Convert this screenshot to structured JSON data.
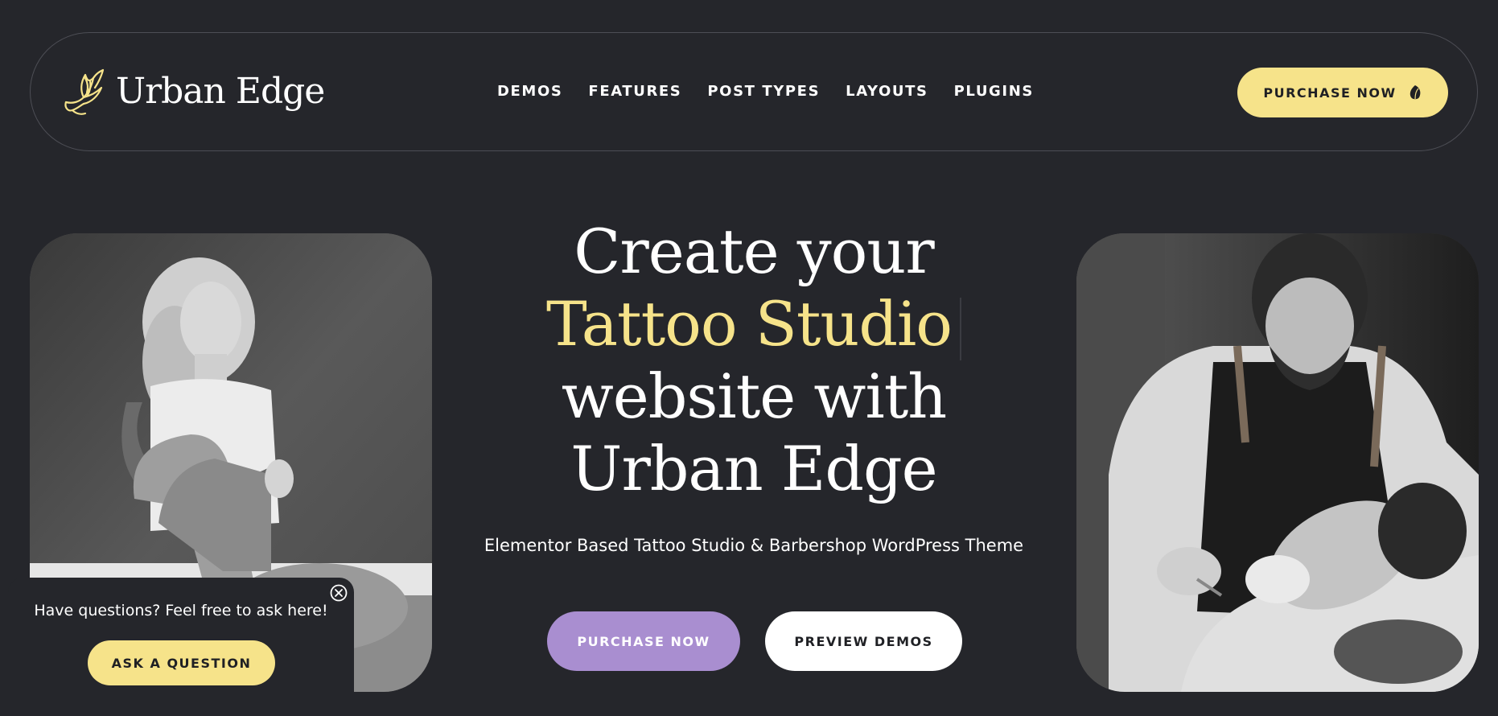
{
  "header": {
    "logo_text": "Urban Edge",
    "logo_icon": "swallow-bird-icon",
    "nav": [
      "DEMOS",
      "FEATURES",
      "POST TYPES",
      "LAYOUTS",
      "PLUGINS"
    ],
    "purchase_label": "PURCHASE NOW",
    "purchase_icon": "leaf-icon"
  },
  "hero": {
    "line1": "Create your",
    "line2": "Tattoo Studio",
    "line3": "website with",
    "line4": "Urban Edge",
    "subtitle": "Elementor Based Tattoo Studio & Barbershop WordPress Theme",
    "primary_button": "PURCHASE NOW",
    "secondary_button": "PREVIEW DEMOS"
  },
  "images": {
    "left": "tattooed-woman-photo",
    "right": "barber-shaving-photo"
  },
  "chat": {
    "text": "Have questions? Feel free to ask here!",
    "button": "ASK A QUESTION",
    "close_icon": "close-circle-icon"
  },
  "colors": {
    "background": "#25262b",
    "accent_yellow": "#f6e38a",
    "accent_purple": "#a98ed0",
    "white": "#ffffff"
  }
}
